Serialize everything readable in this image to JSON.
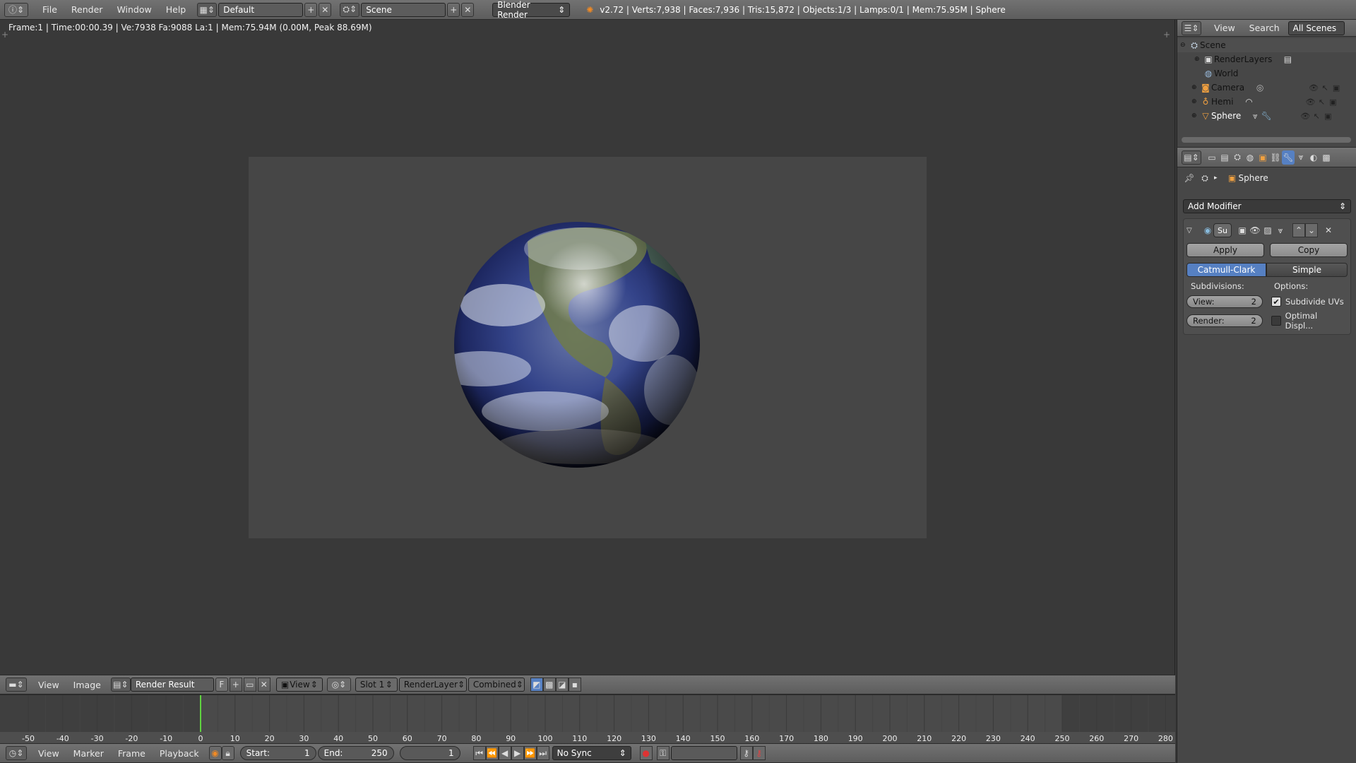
{
  "topbar": {
    "menus": [
      "File",
      "Render",
      "Window",
      "Help"
    ],
    "screen_layout": "Default",
    "scene": "Scene",
    "engine": "Blender Render",
    "stats": "v2.72 | Verts:7,938 | Faces:7,936 | Tris:15,872 | Objects:1/3 | Lamps:0/1 | Mem:75.95M | Sphere"
  },
  "viewer": {
    "info": "Frame:1 | Time:00:00.39 | Ve:7938 Fa:9088 La:1 | Mem:75.94M (0.00M, Peak 88.69M)"
  },
  "image_header": {
    "menus": [
      "View",
      "Image"
    ],
    "image_name": "Render Result",
    "fake_user": "F",
    "view_menu": "View",
    "slot": "Slot 1",
    "render_layer": "RenderLayer",
    "pass": "Combined"
  },
  "timeline": {
    "ticks": [
      "-50",
      "-40",
      "-30",
      "-20",
      "-10",
      "0",
      "10",
      "20",
      "30",
      "40",
      "50",
      "60",
      "70",
      "80",
      "90",
      "100",
      "110",
      "120",
      "130",
      "140",
      "150",
      "160",
      "170",
      "180",
      "190",
      "200",
      "210",
      "220",
      "230",
      "240",
      "250",
      "260",
      "270",
      "280"
    ],
    "current_frame_value": 0,
    "end_frame_value": 250
  },
  "timeline_header": {
    "menus": [
      "View",
      "Marker",
      "Frame",
      "Playback"
    ],
    "start_label": "Start:",
    "start_value": "1",
    "end_label": "End:",
    "end_value": "250",
    "current": "1",
    "sync": "No Sync"
  },
  "outliner": {
    "menus": [
      "View",
      "Search"
    ],
    "filter": "All Scenes",
    "items": [
      {
        "label": "Scene"
      },
      {
        "label": "RenderLayers"
      },
      {
        "label": "World"
      },
      {
        "label": "Camera"
      },
      {
        "label": "Hemi"
      },
      {
        "label": "Sphere"
      }
    ]
  },
  "properties": {
    "breadcrumb_object": "Sphere",
    "add_modifier": "Add Modifier",
    "modifier_name": "Su",
    "apply": "Apply",
    "copy": "Copy",
    "catmull": "Catmull-Clark",
    "simple": "Simple",
    "subdivisions_label": "Subdivisions:",
    "options_label": "Options:",
    "view_label": "View:",
    "view_value": "2",
    "render_label": "Render:",
    "render_value": "2",
    "subdivide_uvs": "Subdivide UVs",
    "subdivide_uvs_checked": true,
    "optimal_display": "Optimal Displ...",
    "optimal_display_checked": false
  },
  "colors": {
    "accent": "#5680c2",
    "frame_cursor": "#5fd340"
  }
}
